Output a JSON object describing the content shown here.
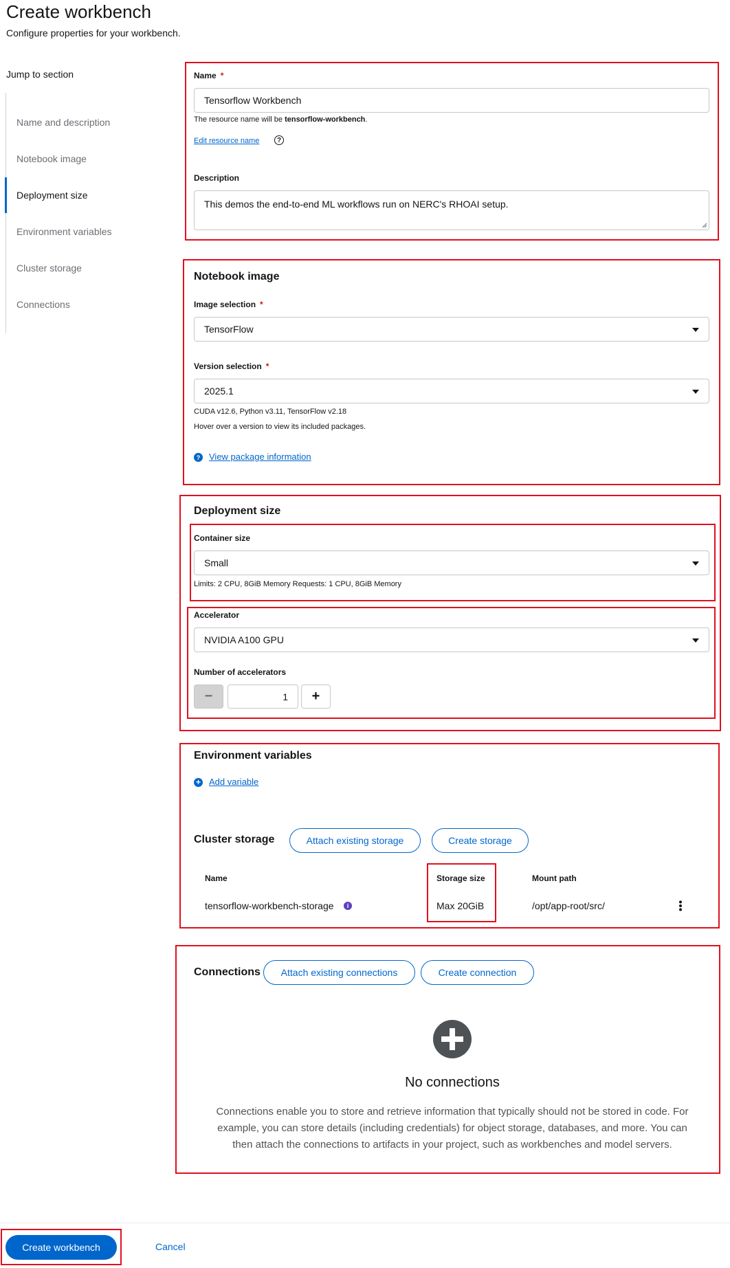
{
  "header": {
    "title": "Create workbench",
    "subtitle": "Configure properties for your workbench."
  },
  "jump": {
    "title": "Jump to section",
    "items": [
      {
        "label": "Name and description"
      },
      {
        "label": "Notebook image"
      },
      {
        "label": "Deployment size"
      },
      {
        "label": "Environment variables"
      },
      {
        "label": "Cluster storage"
      },
      {
        "label": "Connections"
      }
    ],
    "active": "Deployment size"
  },
  "name_section": {
    "name_label": "Name",
    "required_mark": "*",
    "name_value": "Tensorflow Workbench",
    "resource_prefix": "The resource name will be ",
    "resource_name": "tensorflow-workbench",
    "resource_suffix": ".",
    "edit_resource_link": "Edit resource name",
    "description_label": "Description",
    "description_value": "This demos the end-to-end ML workflows run on NERC's RHOAI setup."
  },
  "notebook_image": {
    "title": "Notebook image",
    "image_label": "Image selection",
    "image_value": "TensorFlow",
    "version_label": "Version selection",
    "version_value": "2025.1",
    "version_packages": "CUDA v12.6, Python v3.11, TensorFlow v2.18",
    "version_hint": "Hover over a version to view its included packages.",
    "view_package_link": "View package information"
  },
  "deployment": {
    "title": "Deployment size",
    "container_label": "Container size",
    "container_value": "Small",
    "container_limits": "Limits: 2 CPU, 8GiB Memory Requests: 1 CPU, 8GiB Memory",
    "accelerator_label": "Accelerator",
    "accelerator_value": "NVIDIA A100 GPU",
    "num_accel_label": "Number of accelerators",
    "num_accel_value": "1",
    "minus": "−",
    "plus": "+"
  },
  "env_vars": {
    "title": "Environment variables",
    "add_link": "Add variable"
  },
  "cluster_storage": {
    "title": "Cluster storage",
    "attach_button": "Attach existing storage",
    "create_button": "Create storage",
    "columns": [
      "Name",
      "Storage size",
      "Mount path"
    ],
    "rows": [
      {
        "name": "tensorflow-workbench-storage",
        "size": "Max 20GiB",
        "mount": "/opt/app-root/src/"
      }
    ]
  },
  "connections": {
    "title": "Connections",
    "attach_button": "Attach existing connections",
    "create_button": "Create connection",
    "empty_title": "No connections",
    "empty_body": "Connections enable you to store and retrieve information that typically should not be stored in code. For example, you can store details (including credentials) for object storage, databases, and more. You can then attach the connections to artifacts in your project, such as workbenches and model servers."
  },
  "footer": {
    "create_button": "Create workbench",
    "cancel_button": "Cancel"
  },
  "colors": {
    "accent": "#0066cc",
    "highlight": "#e0101e",
    "required": "#c9190b"
  }
}
